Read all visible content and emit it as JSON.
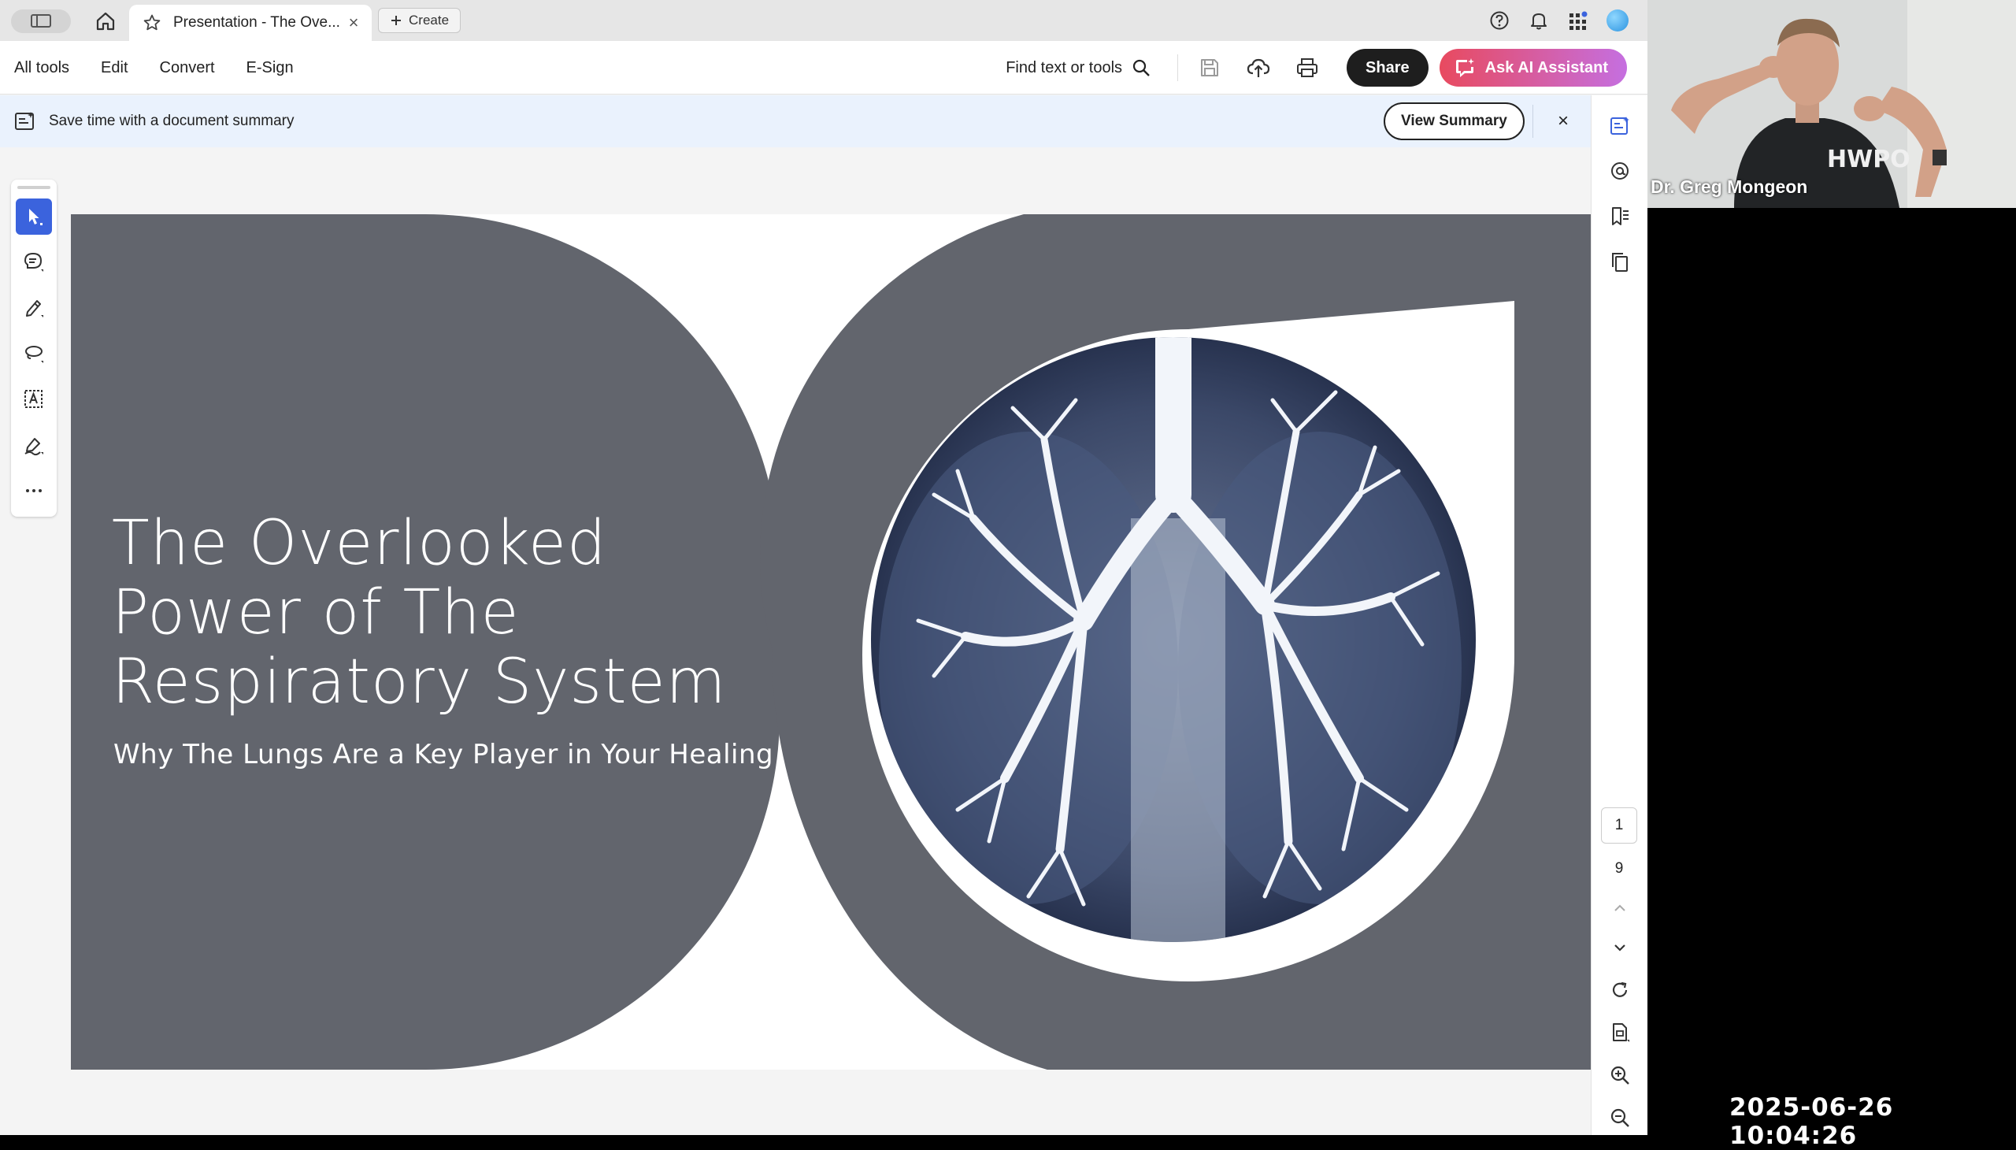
{
  "browser": {
    "tab_title": "Presentation - The Ove...",
    "create_label": "Create"
  },
  "menu": {
    "items": [
      "All tools",
      "Edit",
      "Convert",
      "E-Sign"
    ],
    "find_label": "Find text or tools",
    "share_label": "Share",
    "ai_label": "Ask AI Assistant"
  },
  "banner": {
    "message": "Save time with a document summary",
    "view_label": "View Summary",
    "close_glyph": "×"
  },
  "left_tools": [
    "select-tool",
    "comment-tool",
    "highlight-tool",
    "draw-tool",
    "text-select-tool",
    "sign-tool",
    "more-tools"
  ],
  "right_rail": {
    "current_page": "1",
    "total_pages": "9"
  },
  "slide": {
    "title_line1": "The Overlooked",
    "title_line2": "Power of The",
    "title_line3": "Respiratory System",
    "subtitle": "Why The Lungs Are a Key Player in Your Healing"
  },
  "webcam": {
    "name": "Dr. Greg Mongeon",
    "shirt_text": "HWPO"
  },
  "timestamp": "2025-06-26  10:04:26",
  "colors": {
    "slide_gray": "#62656d",
    "accent_blue": "#3b63dd",
    "banner_bg": "#eaf2fd"
  }
}
